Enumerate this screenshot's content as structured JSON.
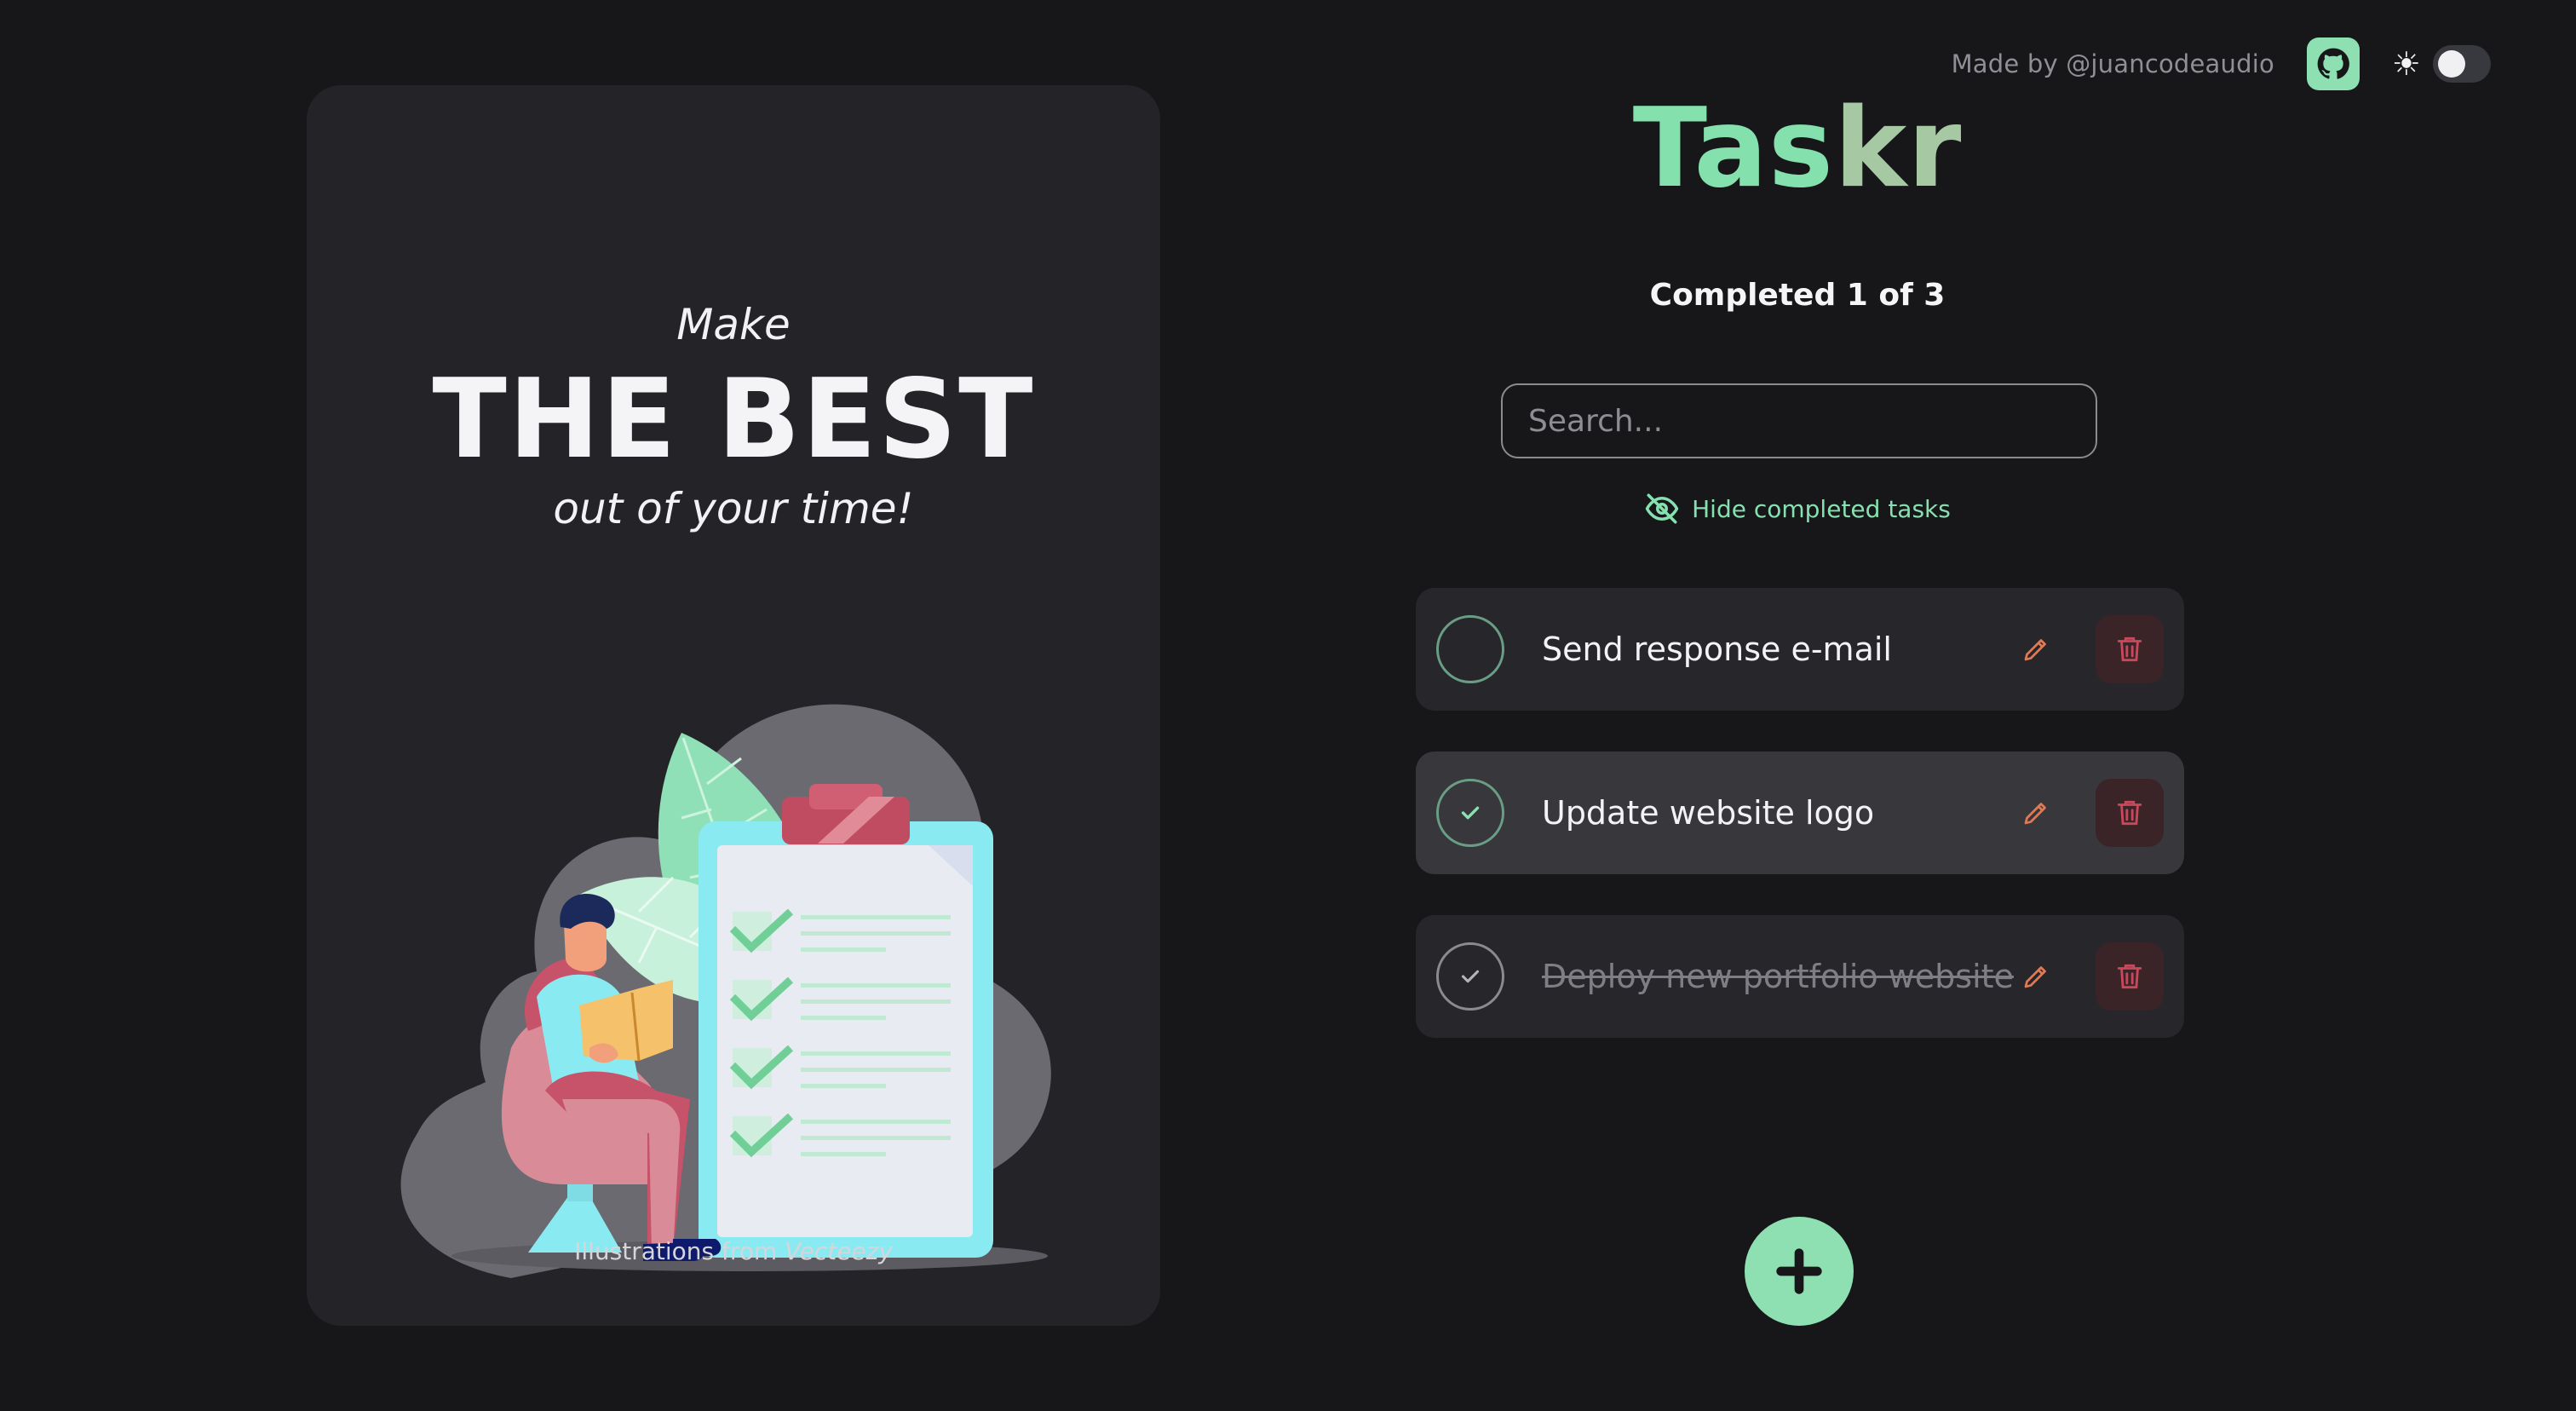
{
  "header": {
    "made_by": "Made by @juancodeaudio",
    "github_icon": "github-icon",
    "theme_icon": "sun-icon",
    "theme_toggle_on": false
  },
  "promo": {
    "line1": "Make",
    "line2": "THE BEST",
    "line3": "out of your time!",
    "credit_prefix": "Illustrations from",
    "credit_source": "Vecteezy"
  },
  "app": {
    "title_a": "Tas",
    "title_b": "kr",
    "counter": "Completed 1 of 3",
    "search_placeholder": "Search...",
    "search_value": "",
    "hide_completed_label": "Hide completed tasks",
    "add_icon": "plus-icon"
  },
  "tasks": [
    {
      "text": "Send response e-mail",
      "completed": false
    },
    {
      "text": "Update website logo",
      "completed": false
    },
    {
      "text": "Deploy new portfolio website",
      "completed": true
    }
  ],
  "colors": {
    "accent": "#8ee0b3",
    "background": "#17171a",
    "card": "#242428",
    "edit": "#e07a55",
    "delete": "#c9495b"
  }
}
